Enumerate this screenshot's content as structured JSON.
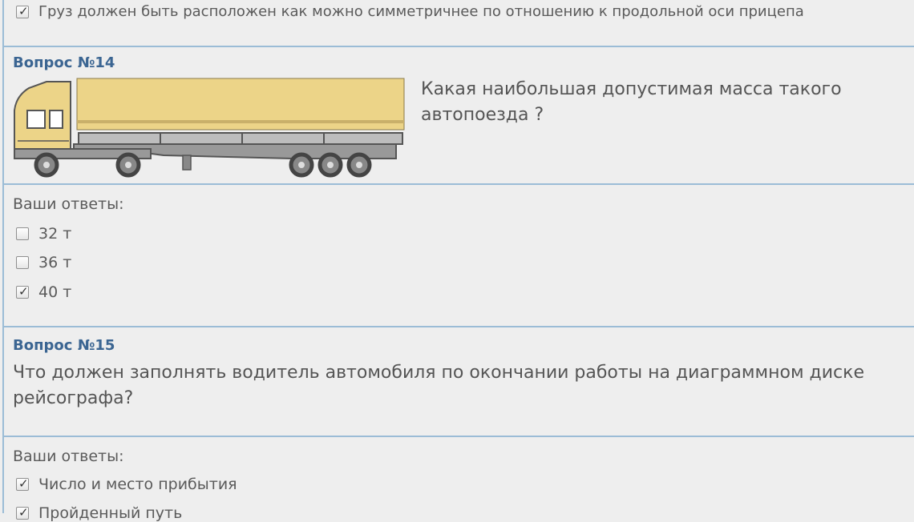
{
  "prev_answer": {
    "label": "Груз должен быть расположен как можно симметричнее по отношению к продольной оси прицепа",
    "checked": true
  },
  "q14": {
    "title": "Вопрос №14",
    "text": "Какая наибольшая допустимая масса такого автопоезда ?",
    "image": "semi-truck-trailer-illustration",
    "answers_label": "Ваши ответы:",
    "options": [
      {
        "label": "32 т",
        "checked": false
      },
      {
        "label": "36 т",
        "checked": false
      },
      {
        "label": "40 т",
        "checked": true
      }
    ]
  },
  "q15": {
    "title": "Вопрос №15",
    "text": "Что должен заполнять водитель автомобиля по окончании работы на диаграммном диске рейсографа?",
    "answers_label": "Ваши ответы:",
    "options": [
      {
        "label": "Число и место прибытия",
        "checked": true
      },
      {
        "label": "Пройденный путь",
        "checked": true
      }
    ]
  },
  "colors": {
    "title": "#3b6592",
    "divider": "#9bbcd6",
    "background": "#eeeeee",
    "trailer": "#ecd488"
  }
}
